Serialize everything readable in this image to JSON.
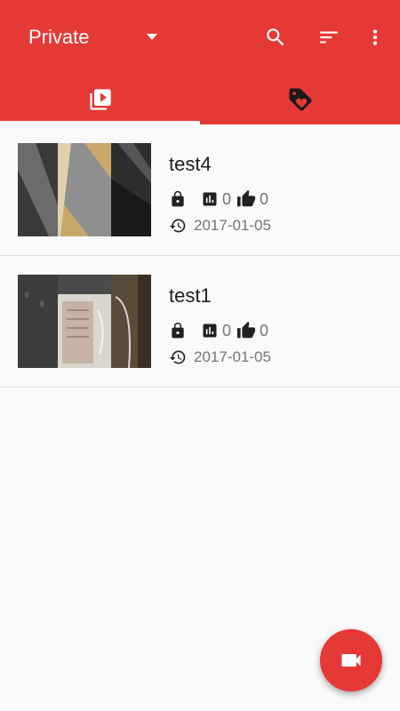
{
  "toolbar": {
    "spinner_label": "Private",
    "actions": [
      "search-icon",
      "sort-icon",
      "more-vert-icon"
    ]
  },
  "tabs": [
    {
      "icon": "video-library-icon",
      "selected": true
    },
    {
      "icon": "tag-heart-icon",
      "selected": false
    }
  ],
  "videos": [
    {
      "title": "test4",
      "lock_icon": "lock-icon",
      "views": "0",
      "likes": "0",
      "date": "2017-01-05"
    },
    {
      "title": "test1",
      "lock_icon": "lock-icon",
      "views": "0",
      "likes": "0",
      "date": "2017-01-05"
    }
  ],
  "fab": {
    "icon": "videocam-icon"
  },
  "colors": {
    "primary": "#e53935",
    "background": "#fafafa",
    "divider": "#dddddd",
    "secondary_text": "#757575"
  }
}
